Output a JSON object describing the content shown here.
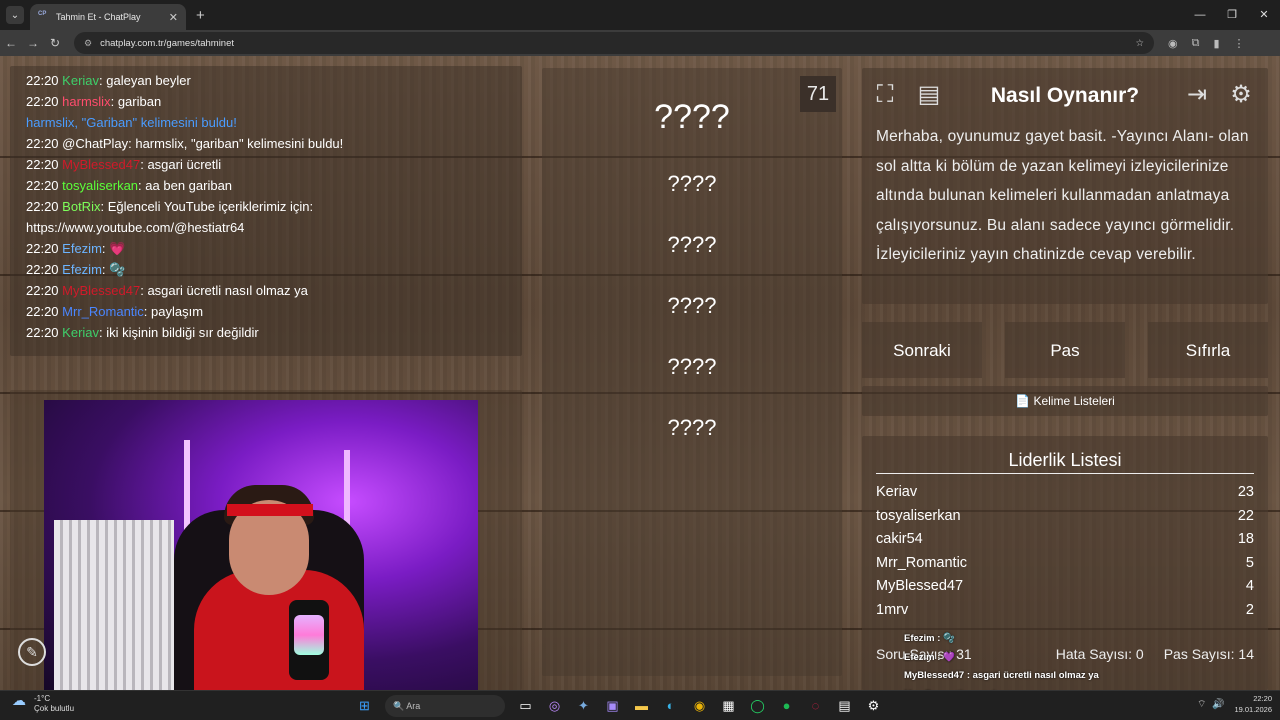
{
  "browser": {
    "tab_title": "Tahmin Et - ChatPlay",
    "tab_favicon": "CP",
    "url": "chatplay.com.tr/games/tahminet"
  },
  "chat": [
    {
      "time": "22:20",
      "user": "Keriav",
      "color": "#3ecf6a",
      "sep": ":",
      "msg": " galeyan beyler"
    },
    {
      "time": "22:20",
      "user": "harmslix",
      "color": "#ff4d6d",
      "sep": ":",
      "msg": " gariban"
    },
    {
      "time": "",
      "user": "",
      "color": "#4a9cff",
      "sep": "",
      "msg": "harmslix, \"Gariban\" kelimesini buldu!",
      "msgcolor": "#4a9cff"
    },
    {
      "time": "22:20",
      "user": "",
      "color": "#ffffff",
      "sep": "",
      "msg": "@ChatPlay: harmslix, \"gariban\" kelimesini buldu!"
    },
    {
      "time": "22:20",
      "user": "MyBlessed47",
      "color": "#d01a2a",
      "sep": ":",
      "msg": " asgari ücretli"
    },
    {
      "time": "22:20",
      "user": "tosyaliserkan",
      "color": "#5bff3a",
      "sep": ":",
      "msg": " aa ben gariban"
    },
    {
      "time": "22:20",
      "user": "BotRix",
      "color": "#7dff5a",
      "sep": ":",
      "msg": " Eğlenceli YouTube içeriklerimiz için:"
    },
    {
      "time": "",
      "user": "",
      "color": "#ffffff",
      "sep": "",
      "msg": "https://www.youtube.com/@hestiatr64"
    },
    {
      "time": "22:20",
      "user": "Efezim",
      "color": "#6cb4ff",
      "sep": ":",
      "msg": " 💗"
    },
    {
      "time": "22:20",
      "user": "Efezim",
      "color": "#6cb4ff",
      "sep": ":",
      "msg": " 🫧"
    },
    {
      "time": "22:20",
      "user": "MyBlessed47",
      "color": "#d01a2a",
      "sep": ":",
      "msg": " asgari ücretli nasıl olmaz ya"
    },
    {
      "time": "22:20",
      "user": "Mrr_Romantic",
      "color": "#4a86ff",
      "sep": ":",
      "msg": " paylaşım"
    },
    {
      "time": "22:20",
      "user": "Keriav",
      "color": "#3ecf6a",
      "sep": ":",
      "msg": " iki kişinin bildiği sır değildir"
    }
  ],
  "game": {
    "timer": "71",
    "words": [
      "????",
      "????",
      "????",
      "????",
      "????",
      "????"
    ],
    "howto_title": "Nasıl Oynanır?",
    "howto_text": "Merhaba, oyunumuz gayet basit. -Yayıncı Alanı- olan sol altta ki bölüm de yazan kelimeyi izleyicilerinize altında bulunan kelimeleri kullanmadan anlatmaya çalışıyorsunuz. Bu alanı sadece yayıncı görmelidir. İzleyicileriniz yayın chatinizde cevap verebilir.",
    "btn_next": "Sonraki",
    "btn_pass": "Pas",
    "btn_reset": "Sıfırla",
    "word_lists": "Kelime Listeleri",
    "leader_title": "Liderlik Listesi",
    "leaders": [
      {
        "name": "Keriav",
        "score": "23"
      },
      {
        "name": "tosyaliserkan",
        "score": "22"
      },
      {
        "name": "cakir54",
        "score": "18"
      },
      {
        "name": "Mrr_Romantic",
        "score": "5"
      },
      {
        "name": "MyBlessed47",
        "score": "4"
      },
      {
        "name": "1mrv",
        "score": "2"
      }
    ],
    "question_label": "Soru Sayısı: 31",
    "error_label": "Hata Sayısı: 0",
    "pass_label": "Pas Sayısı: 14"
  },
  "overlay": [
    "Efezim : 🫧",
    "Efezim : 💜",
    "MyBlessed47 : asgari ücretli nasıl olmaz ya",
    "Mrr_Romantic : paylaşım",
    "Keriav : iki kişinin bildiği sır değildir"
  ],
  "taskbar": {
    "temp": "-1°C",
    "weather": "Çok bulutlu",
    "search": "Ara",
    "time": "22:20",
    "date": "19.01.2026"
  }
}
